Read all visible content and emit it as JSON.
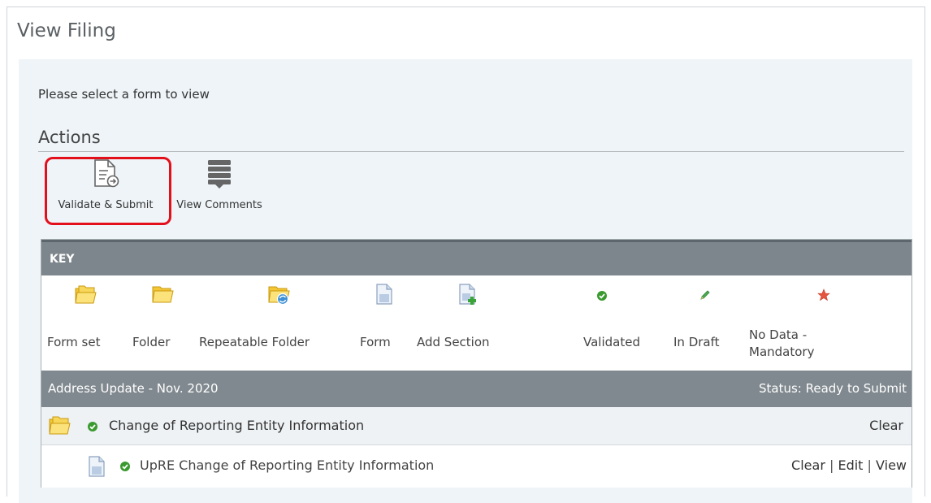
{
  "page": {
    "title": "View Filing"
  },
  "panel": {
    "instruction": "Please select a form to view",
    "actions_title": "Actions"
  },
  "actions": {
    "validate_label": "Validate & Submit",
    "comments_label": "View Comments"
  },
  "key": {
    "header": "KEY",
    "items": [
      {
        "label": "Form set",
        "icon": "form-set-icon"
      },
      {
        "label": "Folder",
        "icon": "folder-icon"
      },
      {
        "label": "Repeatable Folder",
        "icon": "repeatable-folder-icon"
      },
      {
        "label": "Form",
        "icon": "form-icon"
      },
      {
        "label": "Add Section",
        "icon": "add-section-icon"
      },
      {
        "label": "Validated",
        "icon": "validated-icon"
      },
      {
        "label": "In Draft",
        "icon": "in-draft-icon"
      },
      {
        "label": "No Data - Mandatory",
        "icon": "no-data-mandatory-icon"
      }
    ]
  },
  "filing": {
    "name": "Address Update - Nov. 2020",
    "status": "Status: Ready to Submit",
    "rows": [
      {
        "title": "Change of Reporting Entity Information",
        "actions": [
          "Clear"
        ]
      },
      {
        "title": "UpRE Change of Reporting Entity Information",
        "actions": [
          "Clear",
          "Edit",
          "View"
        ]
      }
    ]
  },
  "colors": {
    "highlight": "#e3101c",
    "header_bar": "#7d868c",
    "panel_bg": "#eef4f8",
    "validated_green": "#3a9a2f"
  }
}
